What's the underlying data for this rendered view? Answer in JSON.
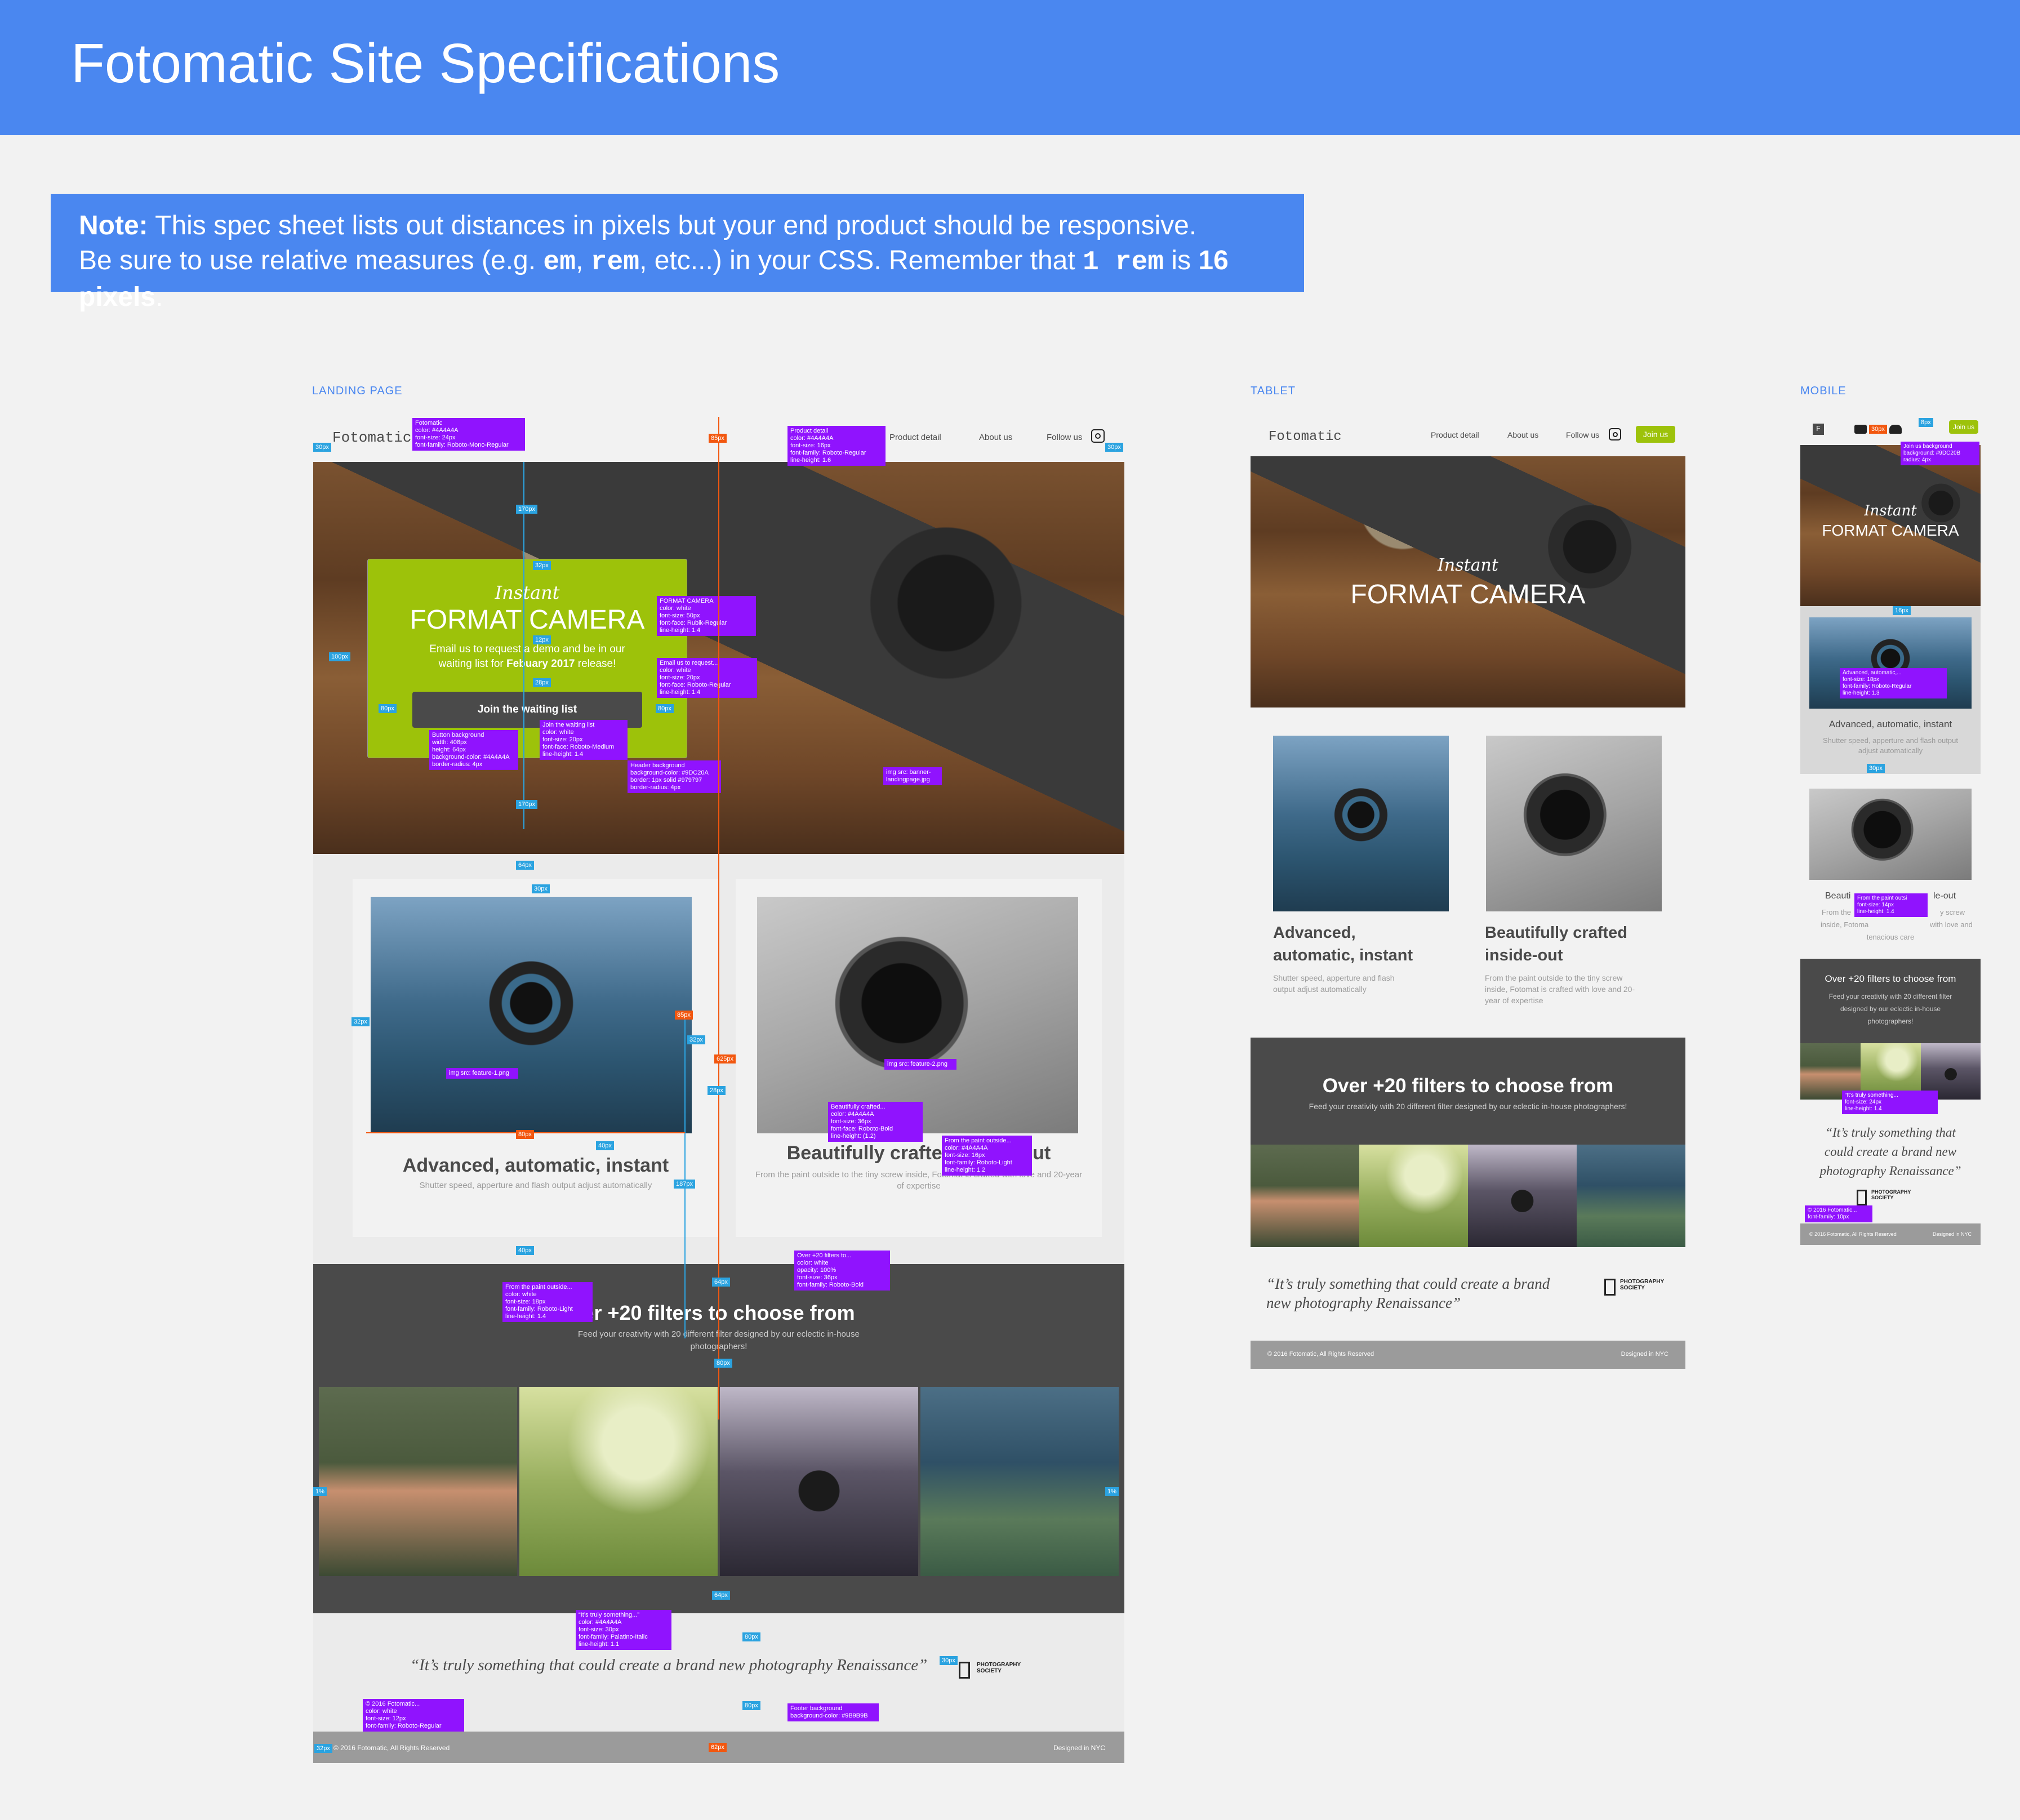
{
  "header": {
    "title": "Fotomatic Site Specifications"
  },
  "note": {
    "label": "Note:",
    "line1": "This spec sheet lists out distances in pixels but your end product should be responsive.",
    "line2a": "Be sure to use relative measures (e.g. ",
    "em": "em",
    "sep": ", ",
    "rem": "rem",
    "line2b": ", etc...) in your CSS. Remember that ",
    "one_rem": "1 rem",
    "is": " is ",
    "sixteen": "16 pixels",
    "end": "."
  },
  "sections": {
    "landing": "LANDING PAGE",
    "tablet": "TABLET",
    "mobile": "MOBILE"
  },
  "site": {
    "logo": "Fotomatic",
    "nav": {
      "product": "Product detail",
      "about": "About us",
      "follow": "Follow us",
      "join": "Join us"
    },
    "hero": {
      "script": "Instant",
      "title": "FORMAT CAMERA",
      "body1": "Email us to request a demo and be in our",
      "body2a": "waiting list for ",
      "body2b": "Febuary 2017",
      "body2c": " release!",
      "cta": "Join the waiting list"
    },
    "features": [
      {
        "title": "Advanced, automatic, instant",
        "text": "Shutter speed, apperture and flash output adjust automatically"
      },
      {
        "title": "Beautifully crafted inside-out",
        "text": "From the paint outside to the tiny screw inside, Fotomat is crafted with love and 20-year of expertise"
      }
    ],
    "tablet_features": [
      {
        "title1": "Advanced,",
        "title2": "automatic, instant",
        "text1": "Shutter speed, apperture and flash",
        "text2": "output adjust automatically"
      },
      {
        "title1": "Beautifully crafted",
        "title2": "inside-out",
        "text1": "From the paint outside to the tiny screw",
        "text2": "inside, Fotomat is crafted with love and 20-",
        "text3": "year of expertise"
      }
    ],
    "filters": {
      "title": "Over +20 filters to choose from",
      "title_partial": "er +20 filters to choose from",
      "sub1": "Feed your creativity with 20 different filter designed by our eclectic in-house",
      "sub2": "photographers!",
      "sub_full": "Feed your creativity with 20 different filter designed by our eclectic in-house photographers!"
    },
    "quote": "“It’s truly something that could create a brand new photography Renaissance”",
    "tablet_quote1": "“It’s truly something that could create a brand",
    "tablet_quote2": "new photography Renaissance”",
    "society1": "PHOTOGRAPHY",
    "society2": "SOCIETY",
    "footer": {
      "copyright": "© 2016 Fotomatic, All Rights Reserved",
      "designed": "Designed in NYC"
    }
  },
  "annotations": {
    "logo": "Fotomatic\ncolor: #4A4A4A\nfont-size: 24px\nfont-family: Roboto-Mono-Regular",
    "product": "Product detail\ncolor: #4A4A4A\nfont-size: 16px\nfont-family: Roboto-Regular\nline-height: 1.6",
    "format": "FORMAT CAMERA\ncolor: white\nfont-size: 50px\nfont-face: Rubik-Regular\nline-height: 1.4",
    "email": "Email us to request...\ncolor: white\nfont-size: 20px\nfont-face: Roboto-Regular\nline-height: 1.4",
    "button": "Button background\nwidth: 408px\nheight: 64px\nbackground-color: #4A4A4A\nborder-radius: 4px",
    "join": "Join the waiting list\ncolor: white\nfont-size: 20px\nfont-face: Roboto-Medium\nline-height: 1.4",
    "header_bg": "Header background\nbackground-color: #9DC20A\nborder: 1px solid #979797\nborder-radius: 4px",
    "banner": "img src: banner-\nlandingpage.jpg",
    "feature1": "img src: feature-1.png",
    "feature2": "img src: feature-2.png",
    "beautifully": "Beautifully crafted...\ncolor: #4A4A4A\nfont-size: 36px\nfont-face: Roboto-Bold\nline-height: (1.2)",
    "paint": "From the paint outside...\ncolor: #4A4A4A\nfont-size: 16px\nfont-family: Roboto-Light\nline-height: 1.2",
    "paint2": "From the paint outside...\ncolor: white\nfont-size: 18px\nfont-family: Roboto-Light\nline-height: 1.4",
    "over": "Over +20 filters to...\ncolor: white\nopacity: 100%\nfont-size: 36px\nfont-family: Roboto-Bold",
    "quote": "“It’s truly something...”\ncolor: #4A4A4A\nfont-size: 30px\nfont-family: Palatino-Italic\nline-height: 1.1",
    "copyright": "© 2016 Fotomatic...\ncolor: white\nfont-size: 12px\nfont-family: Roboto-Regular",
    "footer_bg": "Footer background\nbackground-color: #9B9B9B",
    "m_join": "Join us background\nbackground: #9DC20B\nradius: 4px",
    "m_adv": "Advanced, automatic,...\nfont-size: 18px\nfont-family: Roboto-Regular\nline-height: 1.3",
    "m_paint": "From the paint outsi\nfont-size: 14px\nline-height: 1.4",
    "m_quote": "“It’s truly something...\nfont-size: 24px\nline-height: 1.4",
    "m_copy": "© 2016 Fotomatic...\nfont-family: 10px"
  },
  "badges": {
    "b30": "30px",
    "b85": "85px",
    "b170": "170px",
    "b32": "32px",
    "b12": "12px",
    "b28": "28px",
    "b100": "100px",
    "b80": "80px",
    "b64": "64px",
    "b625": "625px",
    "b187": "187px",
    "b40": "40px",
    "b1pct": "1%",
    "b62": "62px",
    "b16": "16px",
    "b8": "8px"
  },
  "mobile": {
    "script": "Instant",
    "title": "FORMAT CAMERA",
    "f1_title": "Advanced, automatic, instant",
    "f1_text1": "Shutter speed, apperture and flash output",
    "f1_text2": "adjust automatically",
    "f2_title_a": "Beauti",
    "f2_title_b": "le-out",
    "f2_text_a": "From the",
    "f2_text_b": "y screw",
    "f2_text_c": "inside, Fotoma",
    "f2_text_d": "with love and",
    "f2_text_e": "tenacious care",
    "filters_title": "Over +20 filters to choose from",
    "filters_sub1": "Feed your creativity with 20 different filter",
    "filters_sub2": "designed by our eclectic in-house",
    "filters_sub3": "photographers!",
    "quote1": "“It’s truly something that",
    "quote2": "could create a brand new",
    "quote3": "photography Renaissance”",
    "footer_a": "© 2016 Fotomatic, All Rights Reserved",
    "footer_b": "Designed in NYC"
  }
}
